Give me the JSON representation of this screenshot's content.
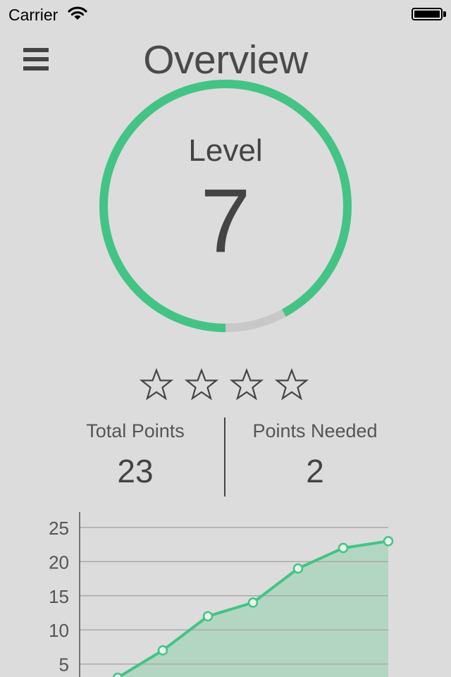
{
  "status_bar": {
    "carrier": "Carrier"
  },
  "header": {
    "title": "Overview"
  },
  "level": {
    "label": "Level",
    "value": "7",
    "progress": 0.92
  },
  "rating": {
    "stars_filled": 0,
    "stars_total": 4
  },
  "stats": {
    "total_points_label": "Total Points",
    "total_points_value": "23",
    "points_needed_label": "Points Needed",
    "points_needed_value": "2"
  },
  "colors": {
    "accent": "#43c484",
    "area_fill": "#b3d6c3",
    "background": "#dcdcdc",
    "ring_track": "#c8c8c8"
  },
  "chart_data": {
    "type": "line",
    "x": [
      1,
      2,
      3,
      4,
      5,
      6,
      7
    ],
    "series": [
      {
        "values": [
          3,
          7,
          12,
          14,
          19,
          22,
          23
        ]
      }
    ],
    "yticks": [
      "25",
      "20",
      "15",
      "10",
      "5"
    ],
    "ylim": [
      0,
      25
    ],
    "grid": true,
    "area_fill": true
  }
}
